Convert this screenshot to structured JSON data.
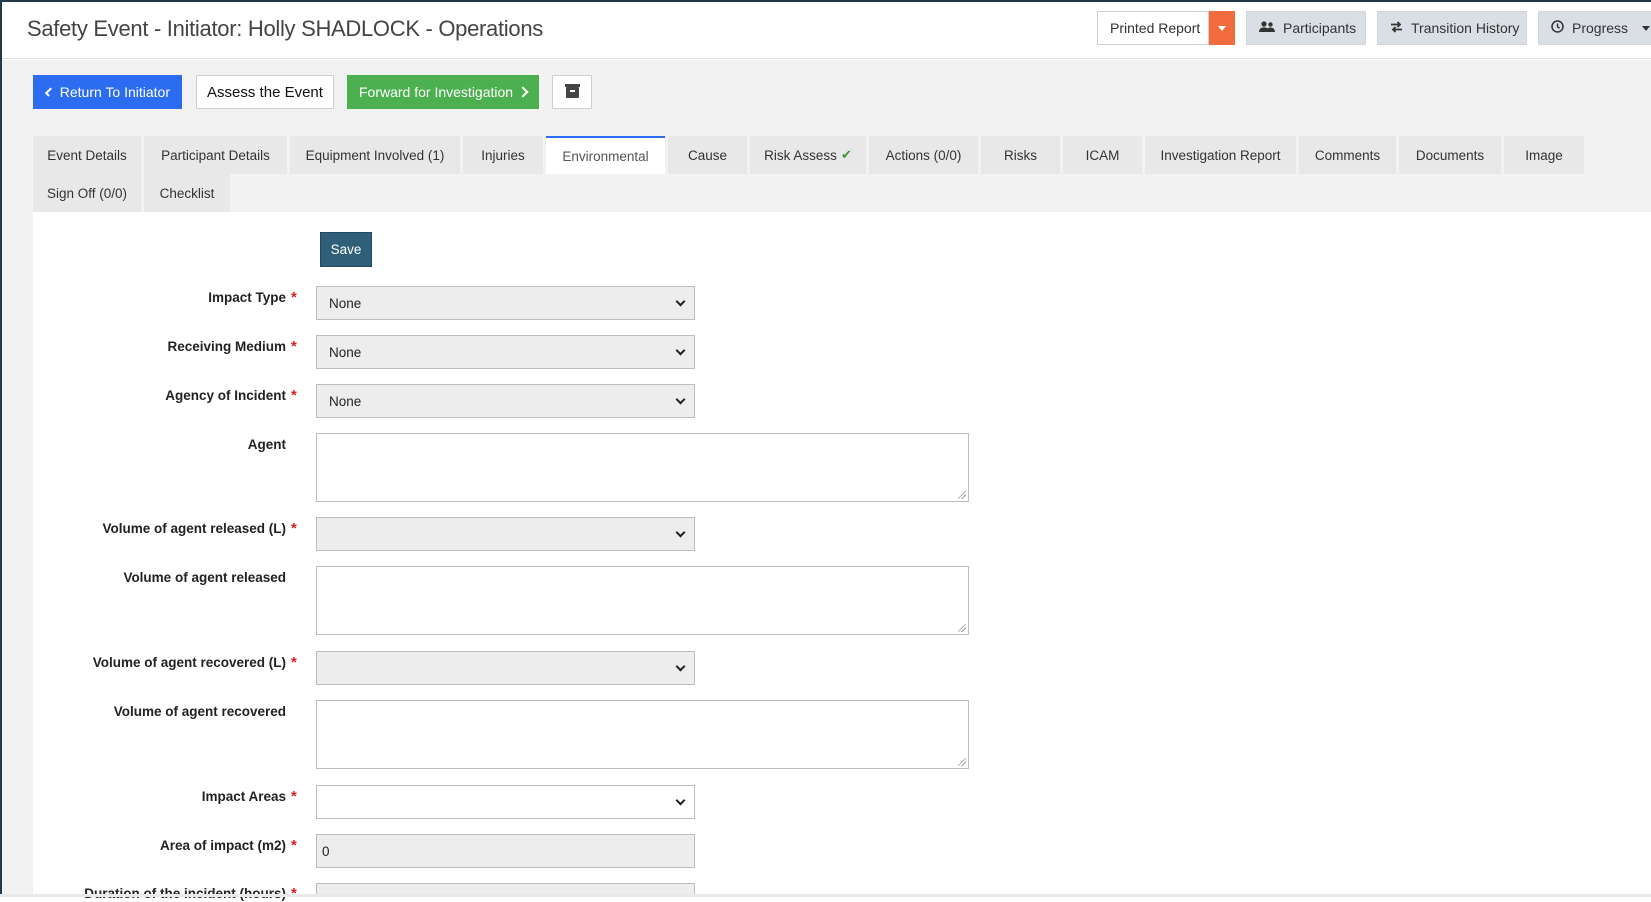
{
  "header": {
    "title": "Safety Event - Initiator: Holly SHADLOCK - Operations",
    "printed_report": "Printed Report",
    "participants": "Participants",
    "transition_history": "Transition History",
    "progress": "Progress",
    "accent_color": "#f36c3d"
  },
  "actions": {
    "return": "Return To Initiator",
    "assess": "Assess the Event",
    "forward": "Forward for Investigation"
  },
  "tabs": [
    "Event Details",
    "Participant Details",
    "Equipment Involved (1)",
    "Injuries",
    "Environmental",
    "Cause",
    "Risk Assess",
    "Actions (0/0)",
    "Risks",
    "ICAM",
    "Investigation Report",
    "Comments",
    "Documents",
    "Image",
    "Sign Off (0/0)",
    "Checklist"
  ],
  "active_tab": "Environmental",
  "form": {
    "save": "Save",
    "impact_type": {
      "label": "Impact Type",
      "value": "None"
    },
    "receiving_medium": {
      "label": "Receiving Medium",
      "value": "None"
    },
    "agency": {
      "label": "Agency of Incident",
      "value": "None"
    },
    "agent": {
      "label": "Agent",
      "value": ""
    },
    "volume_released_l": {
      "label": "Volume of agent released (L)",
      "value": ""
    },
    "volume_released": {
      "label": "Volume of agent released",
      "value": ""
    },
    "volume_recovered_l": {
      "label": "Volume of agent recovered (L)",
      "value": ""
    },
    "volume_recovered": {
      "label": "Volume of agent recovered",
      "value": ""
    },
    "impact_areas": {
      "label": "Impact Areas",
      "value": ""
    },
    "area_of_impact": {
      "label": "Area of impact (m2)",
      "value": "0"
    },
    "duration": {
      "label": "Duration of the incident (hours)",
      "value": ""
    },
    "required_mark": "*"
  }
}
